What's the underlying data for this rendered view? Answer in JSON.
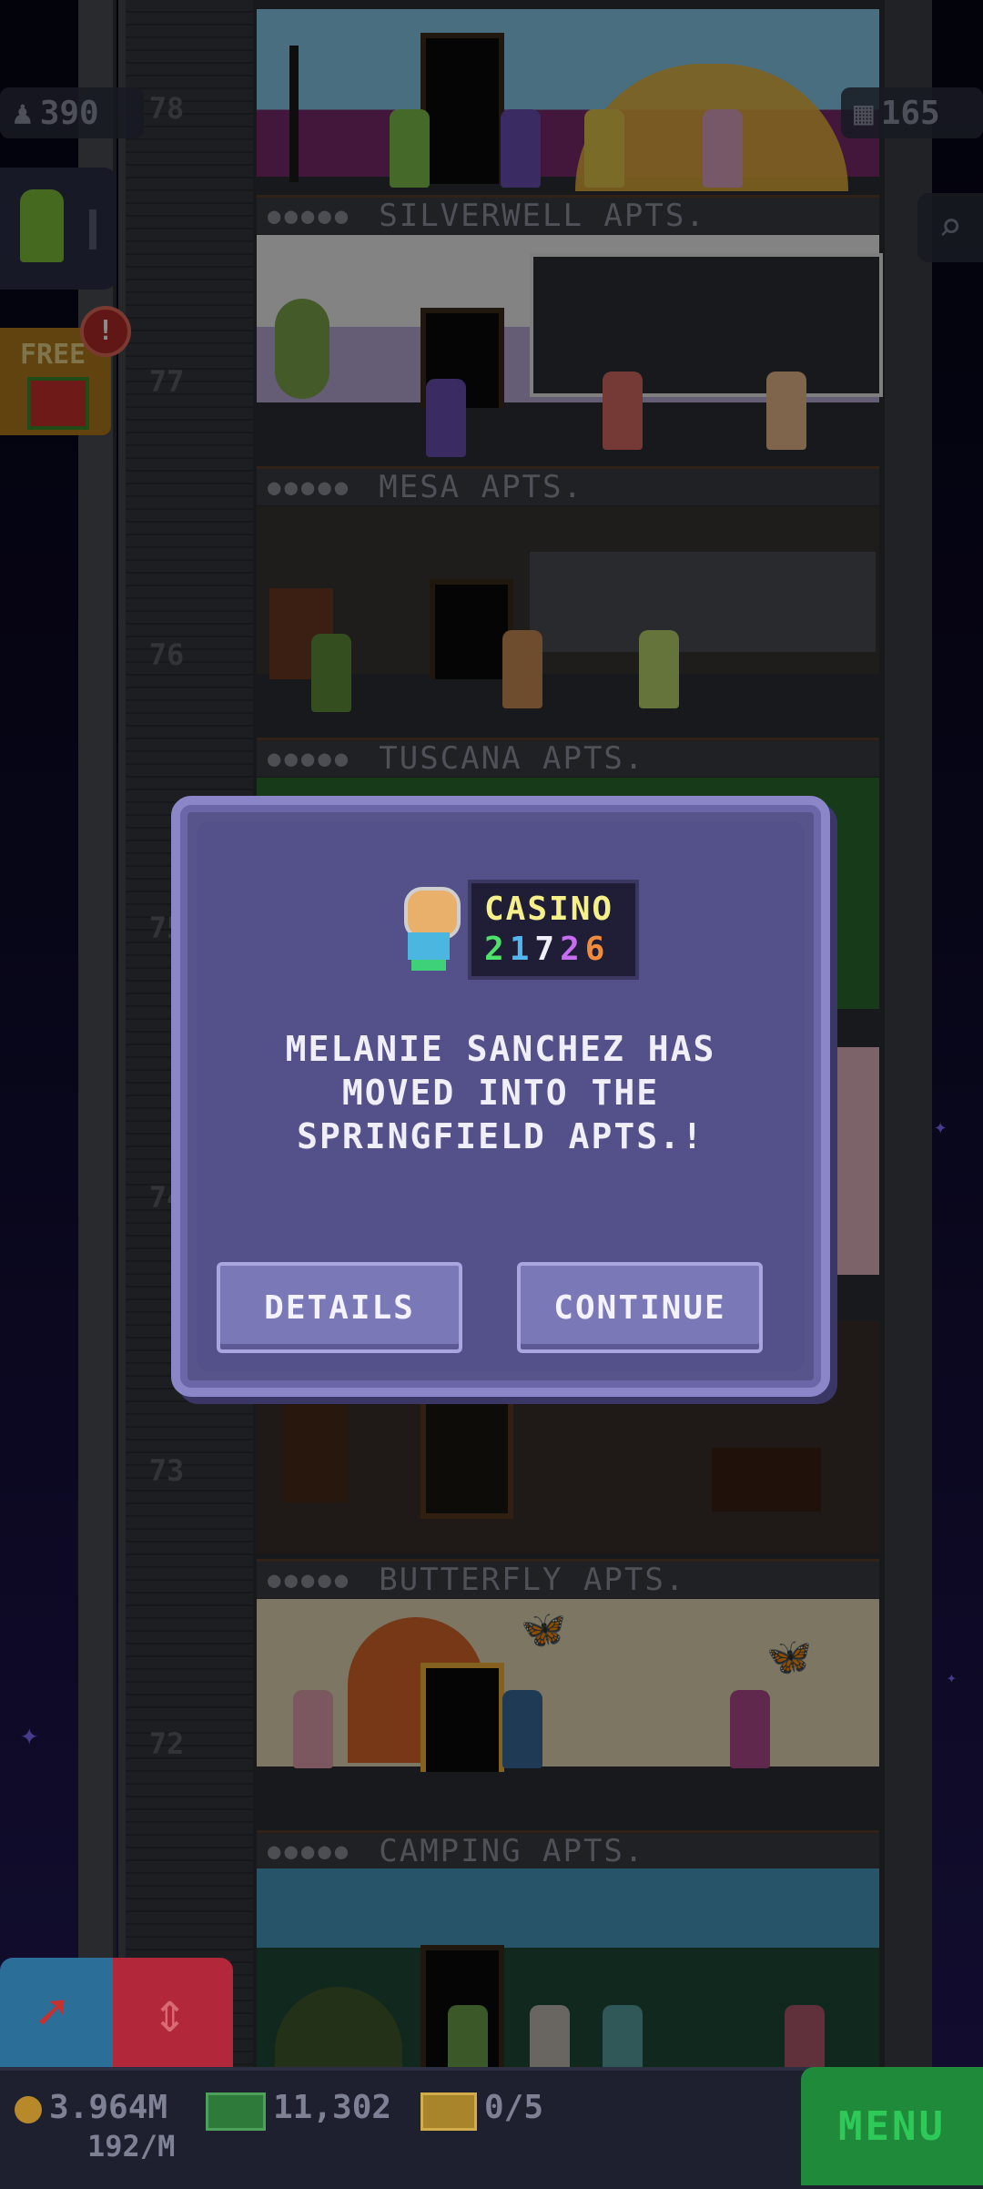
{
  "hud": {
    "population": "390",
    "floor_count": "165",
    "free_label": "FREE",
    "free_badge": "!"
  },
  "floors": [
    {
      "num": "78",
      "label": "SILVERWELL APTS."
    },
    {
      "num": "77",
      "label": "MESA APTS."
    },
    {
      "num": "76",
      "label": "TUSCANA APTS."
    },
    {
      "num": "75",
      "label": ""
    },
    {
      "num": "74",
      "label": ""
    },
    {
      "num": "73",
      "label": "BUTTERFLY APTS."
    },
    {
      "num": "72",
      "label": "CAMPING APTS."
    }
  ],
  "modal": {
    "badge_title": "CASINO",
    "badge_digits": [
      "2",
      "1",
      "7",
      "2",
      "6"
    ],
    "message": "MELANIE SANCHEZ HAS MOVED INTO THE SPRINGFIELD APTS.!",
    "details_label": "DETAILS",
    "continue_label": "CONTINUE"
  },
  "bottom": {
    "coins": "3.964M",
    "coin_rate": "192/M",
    "bux": "11,302",
    "tickets": "0/5",
    "menu_label": "MENU"
  },
  "icons": [
    "person-icon",
    "building-icon",
    "search-icon",
    "gift-icon",
    "coin-icon",
    "bux-icon",
    "ticket-icon",
    "rocket-icon",
    "elevator-arrows-icon"
  ],
  "colors": {
    "modal_bg": "#56548a",
    "modal_border": "#8b86c8",
    "menu_green": "#1f8a3a",
    "casino_yellow": "#f5f08a",
    "digit_colors": [
      "#4de36a",
      "#52b7f0",
      "#f0eef8",
      "#c76df2",
      "#f08a3c"
    ]
  }
}
